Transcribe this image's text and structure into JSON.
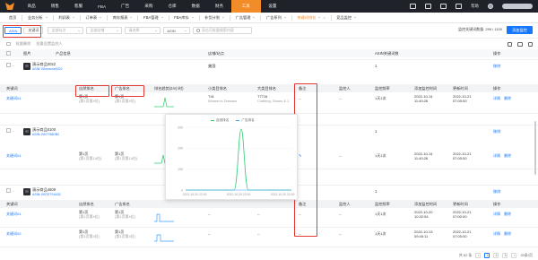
{
  "nav": {
    "items": [
      "商品",
      "销售",
      "客服",
      "FBA",
      "广告",
      "采购",
      "仓库",
      "数据",
      "财务",
      "工具",
      "设置"
    ],
    "active_index": 9,
    "right": {
      "help": "帮助"
    }
  },
  "subnav": {
    "items": [
      "首页",
      "业务分析",
      "利润表",
      "订单表",
      "库存报表",
      "FBA管理",
      "FBA库存",
      "补货计划",
      "广告管理",
      "广告系列",
      "关键词排名",
      "竞品监控"
    ],
    "active_label": "关键词排名"
  },
  "filter": {
    "tabs": [
      "ASIN",
      "关键词"
    ],
    "active_tab": "ASIN",
    "selects": [
      "全部站点",
      "全部店铺",
      "请选择",
      "ASIN"
    ],
    "search_placeholder": "双击可批量搜索内容",
    "quota": "监控关键词数量: 299 / 1100",
    "add_button": "添加监控"
  },
  "toolbar": {
    "delete": "批量删除",
    "settings": "批量设置监控人"
  },
  "product_header": [
    "图片",
    "产品信息",
    "店铺/站点",
    "ASIN关键词数",
    "操作"
  ],
  "products": [
    {
      "name": "演示商品0022",
      "asin": "ASIN: B0xxxxxx0022",
      "shop": "美国",
      "count": "1",
      "action": "移除"
    },
    {
      "name": "演示商品0100",
      "asin": "ASIN: B07Y98DB2",
      "shop": "美国",
      "count": "1",
      "action": "移除"
    },
    {
      "name": "演示商品4609",
      "asin": "ASIN: B07E7S4432",
      "shop": "美国",
      "count": "1",
      "action": "移除"
    }
  ],
  "kw_header": [
    "关键词",
    "自然排名",
    "广告排名",
    "排名趋势(24小时)",
    "小类目排名",
    "大类目排名",
    "备注",
    "监控人",
    "监控频率",
    "添加监控时间",
    "更新时间",
    "操作"
  ],
  "kw_rows": [
    {
      "keyword": "关键词01",
      "natural": "第1页",
      "natural_sub": "(第1页第4位)",
      "ad": "第1页",
      "ad_sub": "(第1页第4位)",
      "sub_rank": "T41",
      "sub_rank_sub": "Women's Dresses",
      "big_rank": "T7716",
      "big_rank_sub": "Clothing, Shoes & J",
      "note": "--",
      "monitor": "--",
      "freq": "1天1次",
      "added": "2022-10-14",
      "added_time": "11:40:26",
      "updated": "2022-10-21",
      "updated_time": "07:00:00",
      "ops": [
        "详情",
        "删除"
      ]
    },
    {
      "keyword": "关键词01",
      "natural": "第1页",
      "natural_sub": "(第1页第14位)",
      "ad": "第1页",
      "ad_sub": "(第1页第14位)",
      "sub_rank": "--",
      "sub_rank_sub": "",
      "big_rank": "--",
      "big_rank_sub": "",
      "note": "--",
      "monitor": "--",
      "freq": "1天1次",
      "added": "2022-10-14",
      "added_time": "11:40:26",
      "updated": "2022-10-21",
      "updated_time": "07:00:00",
      "ops": [
        "详情",
        "删除"
      ]
    },
    {
      "keyword": "关键词01",
      "natural": "第1页",
      "natural_sub": "(第1页第4位)",
      "ad": "第1页",
      "ad_sub": "(第1页第4位)",
      "sub_rank": "--",
      "sub_rank_sub": "",
      "big_rank": "--",
      "big_rank_sub": "",
      "note": "--",
      "monitor": "--",
      "freq": "1天1次",
      "added": "2022-10-20",
      "added_time": "10:32:54",
      "updated": "2022-10-21",
      "updated_time": "07:00:00",
      "ops": [
        "详情",
        "删除"
      ]
    },
    {
      "keyword": "关键词02",
      "natural": "第1页",
      "natural_sub": "(第1页第4位)",
      "ad": "第1页",
      "ad_sub": "(第1页第4位)",
      "sub_rank": "--",
      "sub_rank_sub": "",
      "big_rank": "--",
      "big_rank_sub": "",
      "note": "--",
      "monitor": "--",
      "freq": "1天1次",
      "added": "2022-10-13",
      "added_time": "09:45:11",
      "updated": "2022-10-21",
      "updated_time": "07:00:00",
      "ops": [
        "详情",
        "删除"
      ]
    }
  ],
  "chart_data": {
    "type": "line",
    "x": [
      "2022-10-20 22:00",
      "2022-10-20 22:00",
      "2022-10-20 22:00"
    ],
    "series": [
      {
        "name": "自然排名",
        "color": "#2ecc71"
      },
      {
        "name": "广告排名",
        "color": "#3aa0ff"
      }
    ],
    "yticks": [
      "300",
      "200",
      "100",
      "0"
    ],
    "ylim": [
      0,
      300
    ]
  },
  "pager": {
    "total": "共 62 条",
    "pages": [
      "1",
      "2",
      "3"
    ],
    "size": "20条/页"
  }
}
